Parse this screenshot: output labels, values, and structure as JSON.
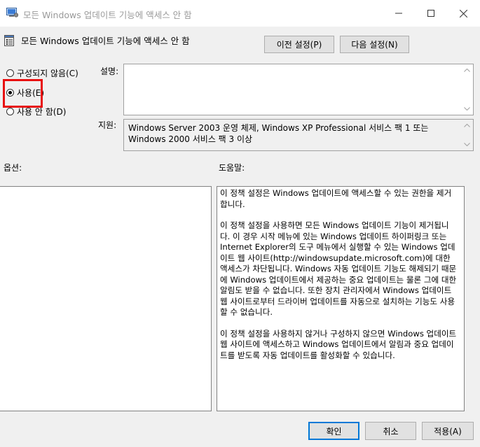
{
  "window": {
    "title": "모든 Windows 업데이트 기능에 액세스 안 함",
    "app_icon": "group-policy-icon",
    "controls": [
      "minimize-icon",
      "maximize-icon",
      "close-icon"
    ]
  },
  "header": {
    "title": "모든 Windows 업데이트 기능에 액세스 안 함",
    "icon": "policy-setting-icon",
    "prev_button": "이전 설정(P)",
    "next_button": "다음 설정(N)"
  },
  "state": {
    "options": [
      {
        "label": "구성되지 않음(C)",
        "selected": false
      },
      {
        "label": "사용(E)",
        "selected": true
      },
      {
        "label": "사용 안 함(D)",
        "selected": false
      }
    ],
    "highlight_color": "#e81010"
  },
  "comment": {
    "label": "설명:",
    "value": ""
  },
  "support": {
    "label": "지원:",
    "text": "Windows Server 2003 운영 체제, Windows XP Professional 서비스 팩 1 또는 Windows 2000 서비스 팩 3 이상"
  },
  "options_label": "옵션:",
  "help": {
    "label": "도움말:",
    "paragraphs": [
      "이 정책 설정은 Windows 업데이트에 액세스할 수 있는 권한을 제거합니다.",
      "이 정책 설정을 사용하면 모든 Windows 업데이트 기능이 제거됩니다. 이 경우 시작 메뉴에 있는 Windows 업데이트 하이퍼링크 또는 Internet Explorer의 도구 메뉴에서 실행할 수 있는 Windows 업데이트 웹 사이트(http://windowsupdate.microsoft.com)에 대한 액세스가 차단됩니다. Windows 자동 업데이트 기능도 해제되기 때문에 Windows 업데이트에서 제공하는 중요 업데이트는 물론 그에 대한 알림도 받을 수 없습니다. 또한 장치 관리자에서 Windows 업데이트 웹 사이트로부터 드라이버 업데이트를 자동으로 설치하는 기능도 사용할 수 없습니다.",
      "이 정책 설정을 사용하지 않거나 구성하지 않으면 Windows 업데이트 웹 사이트에 액세스하고 Windows 업데이트에서 알림과 중요 업데이트를 받도록 자동 업데이트를 활성화할 수 있습니다."
    ]
  },
  "footer": {
    "ok": "확인",
    "cancel": "취소",
    "apply": "적용(A)"
  },
  "colors": {
    "window_bg": "#f0f0f0",
    "accent": "#0078d7",
    "title_text": "#9a9a9a"
  }
}
